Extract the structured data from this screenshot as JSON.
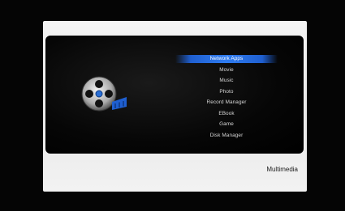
{
  "menu": {
    "items": [
      {
        "label": "Network Apps",
        "selected": true
      },
      {
        "label": "Movie",
        "selected": false
      },
      {
        "label": "Music",
        "selected": false
      },
      {
        "label": "Photo",
        "selected": false
      },
      {
        "label": "Record Manager",
        "selected": false
      },
      {
        "label": "EBook",
        "selected": false
      },
      {
        "label": "Game",
        "selected": false
      },
      {
        "label": "Disk Manager",
        "selected": false
      }
    ]
  },
  "section": {
    "title": "Multimedia",
    "icon": "film-reel-icon"
  },
  "colors": {
    "highlight": "#2f7cf0",
    "panel": "#f0f0f0",
    "screen": "#080808"
  }
}
